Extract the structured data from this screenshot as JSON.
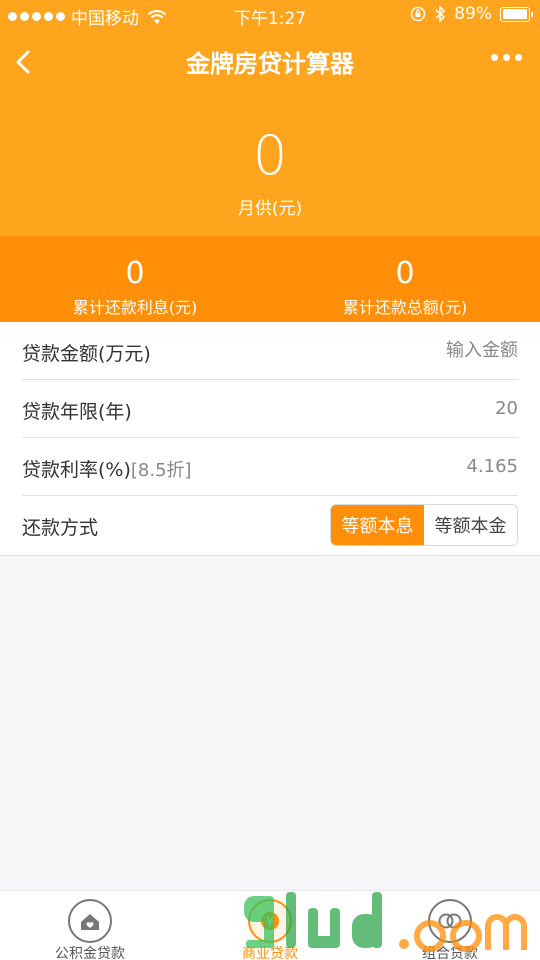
{
  "status_bar": {
    "carrier": "中国移动",
    "time": "下午1:27",
    "battery": "89%"
  },
  "nav": {
    "title": "金牌房贷计算器"
  },
  "summary": {
    "monthly_value": "0",
    "monthly_label": "月供(元)",
    "interest_value": "0",
    "interest_label": "累计还款利息(元)",
    "total_value": "0",
    "total_label": "累计还款总额(元)"
  },
  "form": {
    "amount_label": "贷款金额(万元)",
    "amount_placeholder": "输入金额",
    "term_label": "贷款年限(年)",
    "term_value": "20",
    "rate_label": "贷款利率(%)",
    "rate_discount": "[8.5折]",
    "rate_value": "4.165",
    "method_label": "还款方式",
    "method_options": [
      "等额本息",
      "等额本金"
    ]
  },
  "tabs": [
    {
      "label": "公积金贷款",
      "icon": "house-icon"
    },
    {
      "label": "商业贷款",
      "icon": "coin-icon"
    },
    {
      "label": "组合贷款",
      "icon": "combo-icon"
    }
  ],
  "colors": {
    "header": "#ffa51d",
    "summary": "#ff8e08",
    "accent": "#ff8e08"
  }
}
